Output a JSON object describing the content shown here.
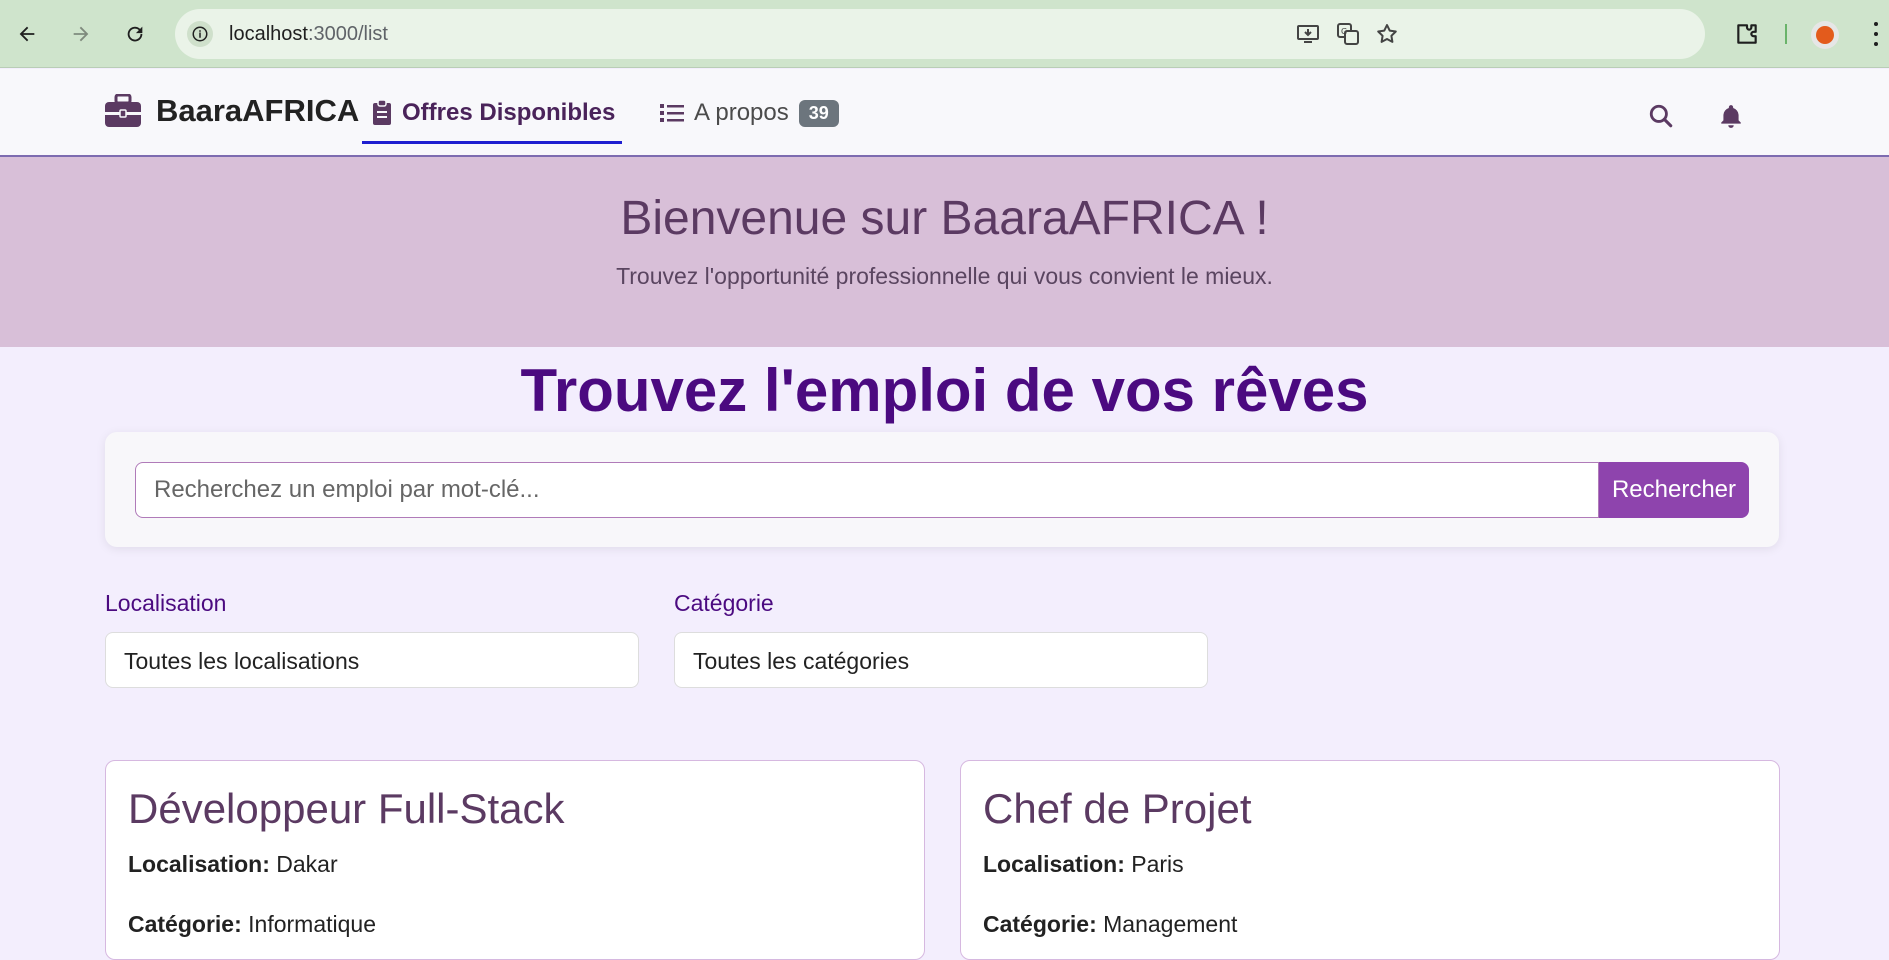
{
  "browser": {
    "url_host": "localhost",
    "url_path": ":3000/list"
  },
  "navbar": {
    "brand": "BaaraAFRICA",
    "offres_label": "Offres Disponibles",
    "apropos_label": "A propos",
    "apropos_badge": "39"
  },
  "hero": {
    "title": "Bienvenue sur BaaraAFRICA !",
    "subtitle": "Trouvez l'opportunité professionnelle qui vous convient le mieux."
  },
  "main": {
    "title": "Trouvez l'emploi de vos rêves",
    "search_placeholder": "Recherchez un emploi par mot-clé...",
    "search_button": "Rechercher"
  },
  "filters": {
    "location_label": "Localisation",
    "location_value": "Toutes les localisations",
    "category_label": "Catégorie",
    "category_value": "Toutes les catégories"
  },
  "jobs": [
    {
      "title": "Développeur Full-Stack",
      "location_label": "Localisation:",
      "location": "Dakar",
      "category_label": "Catégorie:",
      "category": "Informatique"
    },
    {
      "title": "Chef de Projet",
      "location_label": "Localisation:",
      "location": "Paris",
      "category_label": "Catégorie:",
      "category": "Management"
    }
  ],
  "colors": {
    "accent": "#8e44ad",
    "hero_bg": "#d8bfd8",
    "title": "#4b0a80",
    "page_bg": "#f3eefd"
  }
}
